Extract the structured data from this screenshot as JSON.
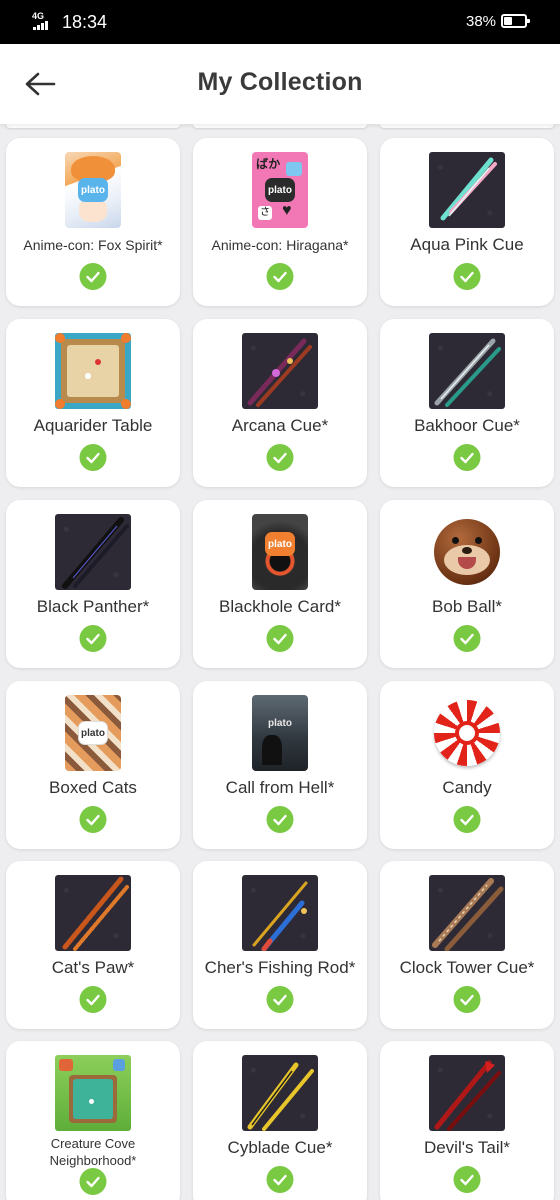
{
  "status_bar": {
    "network": "4G",
    "time": "18:34",
    "battery": "38%",
    "battery_level": 0.38
  },
  "header": {
    "title": "My Collection",
    "back_icon": "arrow-left-icon"
  },
  "items": [
    {
      "label": "Anime-con: Fox Spirit*",
      "thumb": "plato-card-fox",
      "collected": true
    },
    {
      "label": "Anime-con: Hiragana*",
      "thumb": "plato-card-hiragana",
      "collected": true
    },
    {
      "label": "Aqua Pink Cue",
      "thumb": "cue-aqua-pink",
      "collected": true
    },
    {
      "label": "Aquarider Table",
      "thumb": "table-aquarider",
      "collected": true
    },
    {
      "label": "Arcana Cue*",
      "thumb": "cue-arcana",
      "collected": true
    },
    {
      "label": "Bakhoor Cue*",
      "thumb": "cue-bakhoor",
      "collected": true
    },
    {
      "label": "Black Panther*",
      "thumb": "cue-black-panther",
      "collected": true
    },
    {
      "label": "Blackhole Card*",
      "thumb": "plato-card-blackhole",
      "collected": true
    },
    {
      "label": "Bob Ball*",
      "thumb": "ball-bob",
      "collected": true
    },
    {
      "label": "Boxed Cats",
      "thumb": "plato-card-boxed-cats",
      "collected": true
    },
    {
      "label": "Call from Hell*",
      "thumb": "plato-card-call-from-hell",
      "collected": true
    },
    {
      "label": "Candy",
      "thumb": "ball-candy",
      "collected": true
    },
    {
      "label": "Cat's Paw*",
      "thumb": "cue-cats-paw",
      "collected": true
    },
    {
      "label": "Cher's Fishing Rod*",
      "thumb": "cue-fishing-rod",
      "collected": true
    },
    {
      "label": "Clock Tower Cue*",
      "thumb": "cue-clock-tower",
      "collected": true
    },
    {
      "label": "Creature Cove Neighborhood*",
      "thumb": "table-creature-cove",
      "collected": true
    },
    {
      "label": "Cyblade Cue*",
      "thumb": "cue-cyblade",
      "collected": true
    },
    {
      "label": "Devil's Tail*",
      "thumb": "cue-devils-tail",
      "collected": true
    }
  ],
  "colors": {
    "check": "#7ac943",
    "background": "#eeeef0",
    "card": "#ffffff",
    "title": "#3a3a3a"
  }
}
